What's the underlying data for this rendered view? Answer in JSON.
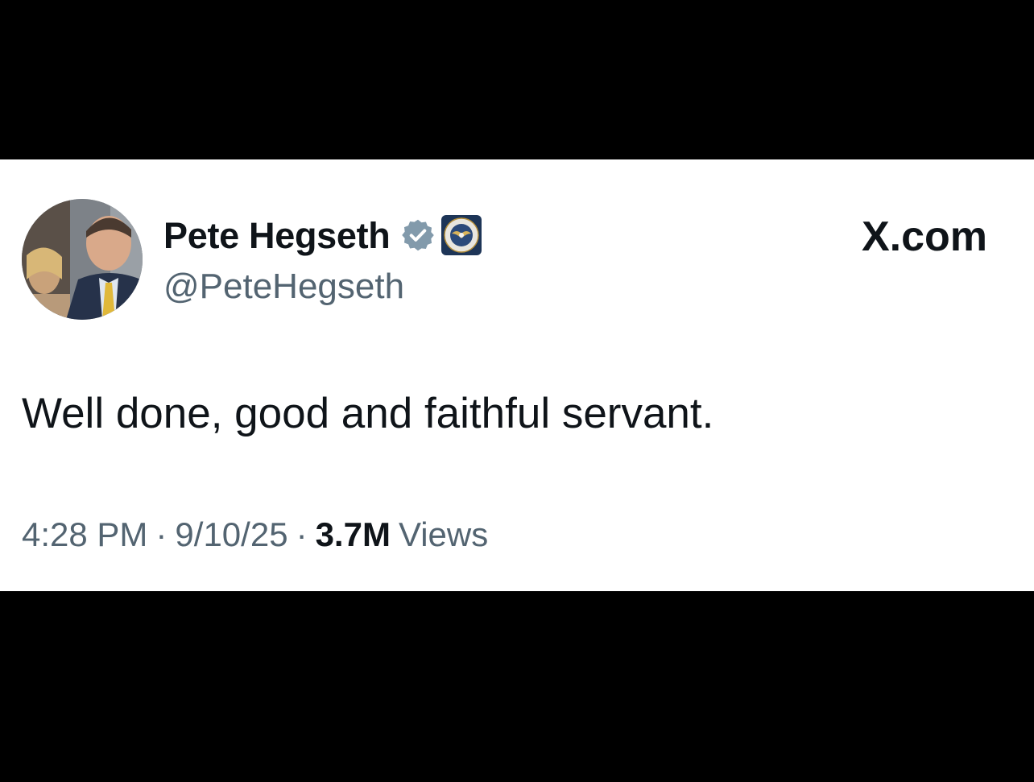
{
  "tweet": {
    "author": {
      "display_name": "Pete Hegseth",
      "handle": "@PeteHegseth",
      "verified_icon": "verified-badge-icon",
      "affiliate_icon": "department-seal-icon"
    },
    "brand": "X.com",
    "text": "Well done, good and faithful servant.",
    "time": "4:28 PM",
    "date": "9/10/25",
    "separator": "·",
    "views_count": "3.7M",
    "views_label": "Views"
  },
  "colors": {
    "background_band": "#000000",
    "card": "#ffffff",
    "primary_text": "#0f1419",
    "secondary_text": "#536471",
    "verified_badge": "#829aab",
    "seal": "#1d3557"
  }
}
